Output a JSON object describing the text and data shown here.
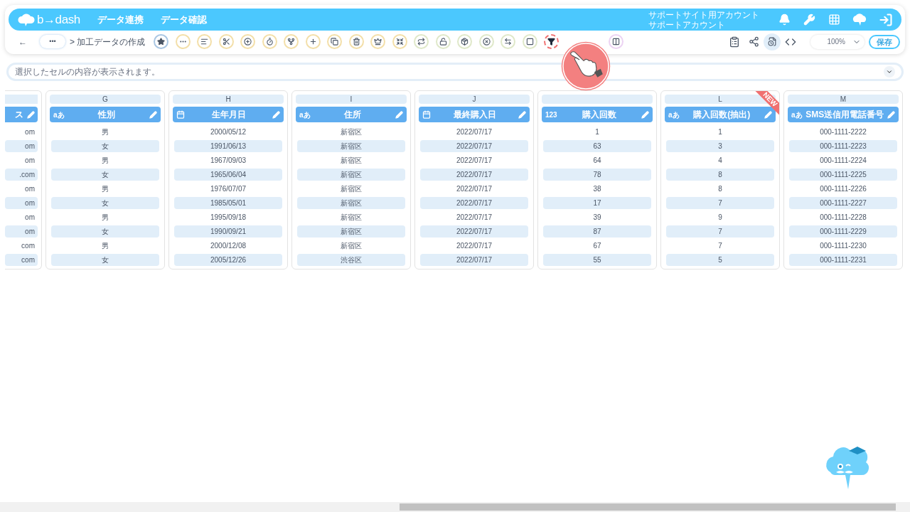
{
  "header": {
    "logo": "b→dash",
    "nav": [
      "データ連携",
      "データ確認"
    ],
    "account": [
      "サポートサイト用アカウント",
      "サポートアカウント"
    ]
  },
  "toolbar": {
    "back": "←",
    "more": "•••",
    "breadcrumb": "> 加工データの作成",
    "tools": [
      {
        "color": "#a9c6e3",
        "highlighted": false
      },
      {
        "color": "#f3dfa9",
        "highlighted": false
      },
      {
        "color": "#f3dfa9",
        "highlighted": false
      },
      {
        "color": "#f3dfa9",
        "highlighted": false
      },
      {
        "color": "#f3dfa9",
        "highlighted": false
      },
      {
        "color": "#f3dfa9",
        "highlighted": false
      },
      {
        "color": "#f3dfa9",
        "highlighted": false
      },
      {
        "color": "#f3dfa9",
        "highlighted": false
      },
      {
        "color": "#f3dfa9",
        "highlighted": false
      },
      {
        "color": "#f3dfa9",
        "highlighted": false
      },
      {
        "color": "#f3dfa9",
        "highlighted": false
      },
      {
        "color": "#f3dfa9",
        "highlighted": false
      },
      {
        "color": "#dfe8c9",
        "highlighted": false
      },
      {
        "color": "#dfe8c9",
        "highlighted": false
      },
      {
        "color": "#dfe8c9",
        "highlighted": false
      },
      {
        "color": "#dfe8c9",
        "highlighted": false
      },
      {
        "color": "#dfe8c9",
        "highlighted": false
      },
      {
        "color": "#dfe8c9",
        "highlighted": false
      },
      {
        "color": "#f07070",
        "highlighted": true
      },
      {
        "color": "#ecd3f3",
        "highlighted": false
      }
    ],
    "zoom": "100%",
    "save": "保存"
  },
  "cell_viewer": {
    "placeholder": "選択したセルの内容が表示されます。"
  },
  "columns": [
    {
      "kind": "partial",
      "title": "ス",
      "cells": [
        "om",
        "om",
        "om",
        ".com",
        "om",
        "om",
        "om",
        "om",
        "com",
        "com"
      ]
    },
    {
      "letter": "G",
      "kind": "text",
      "badge": "aあ",
      "title": "性別",
      "cells": [
        "男",
        "女",
        "男",
        "女",
        "男",
        "女",
        "男",
        "女",
        "男",
        "女"
      ]
    },
    {
      "letter": "H",
      "kind": "date",
      "title": "生年月日",
      "cells": [
        "2000/05/12",
        "1991/06/13",
        "1967/09/03",
        "1965/06/04",
        "1976/07/07",
        "1985/05/01",
        "1995/09/18",
        "1990/09/21",
        "2000/12/08",
        "2005/12/26"
      ]
    },
    {
      "letter": "I",
      "kind": "text",
      "badge": "aあ",
      "title": "住所",
      "cells": [
        "新宿区",
        "新宿区",
        "新宿区",
        "新宿区",
        "新宿区",
        "新宿区",
        "新宿区",
        "新宿区",
        "新宿区",
        "渋谷区"
      ]
    },
    {
      "letter": "J",
      "kind": "date",
      "title": "最終購入日",
      "cells": [
        "2022/07/17",
        "2022/07/17",
        "2022/07/17",
        "2022/07/17",
        "2022/07/17",
        "2022/07/17",
        "2022/07/17",
        "2022/07/17",
        "2022/07/17",
        "2022/07/17"
      ]
    },
    {
      "kind": "number",
      "badge": "123",
      "title": "購入回数",
      "cells": [
        "1",
        "63",
        "64",
        "78",
        "38",
        "17",
        "39",
        "87",
        "67",
        "55"
      ]
    },
    {
      "letter": "L",
      "kind": "text",
      "badge": "aあ",
      "ribbon": "NEW",
      "title": "購入回数(抽出)",
      "cells": [
        "1",
        "3",
        "4",
        "8",
        "8",
        "7",
        "9",
        "7",
        "7",
        "5"
      ]
    },
    {
      "letter": "M",
      "kind": "text",
      "badge": "aあ",
      "title": "SMS送信用電話番号",
      "cells": [
        "000-1111-2222",
        "000-1111-2223",
        "000-1111-2224",
        "000-1111-2225",
        "000-1111-2226",
        "000-1111-2227",
        "000-1111-2228",
        "000-1111-2229",
        "000-1111-2230",
        "000-1111-2231"
      ]
    }
  ]
}
